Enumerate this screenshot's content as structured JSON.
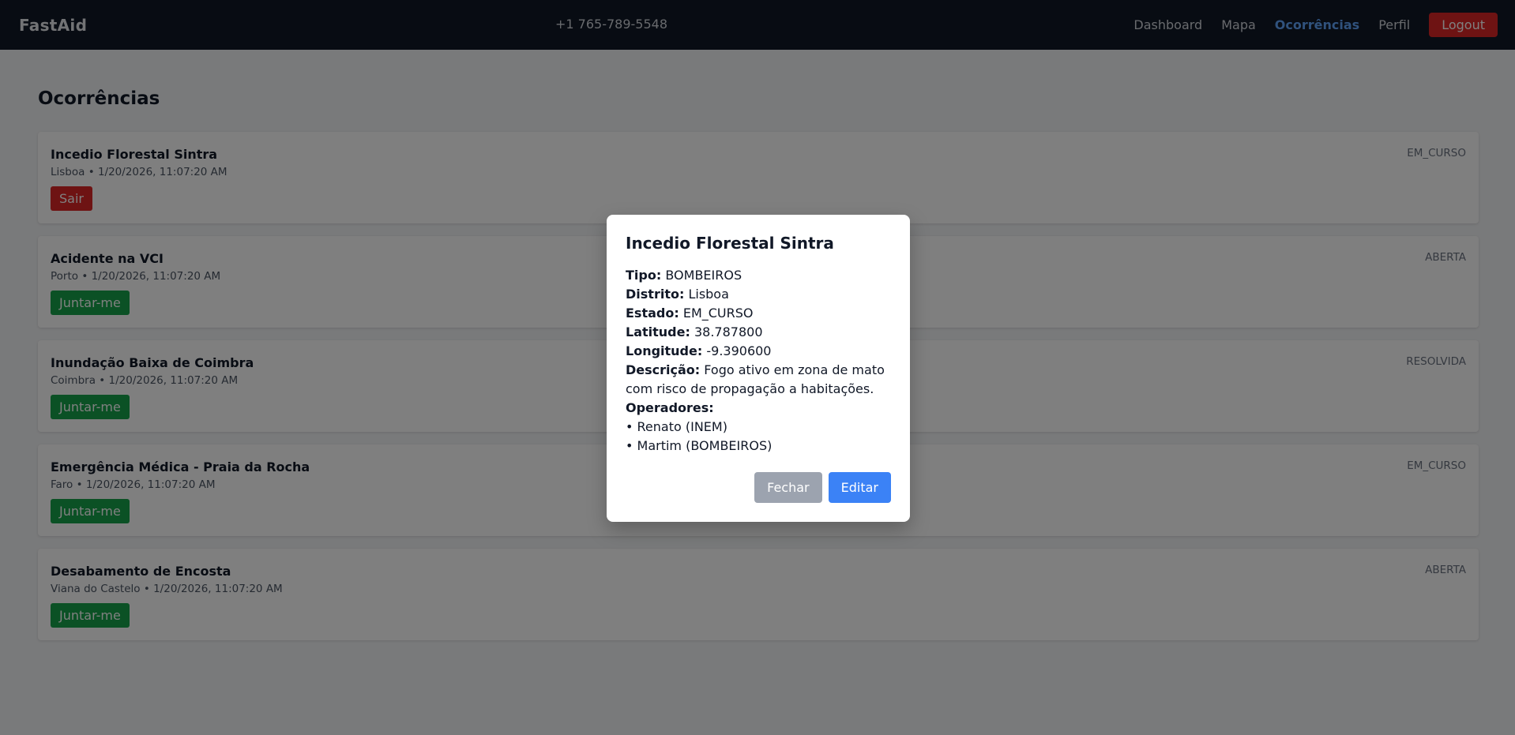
{
  "navbar": {
    "brand": "FastAid",
    "phone": "+1 765-789-5548",
    "links": [
      {
        "label": "Dashboard",
        "active": false
      },
      {
        "label": "Mapa",
        "active": false
      },
      {
        "label": "Ocorrências",
        "active": true
      },
      {
        "label": "Perfil",
        "active": false
      }
    ],
    "logout_label": "Logout"
  },
  "page": {
    "title": "Ocorrências",
    "occurrences": [
      {
        "title": "Incedio Florestal Sintra",
        "meta": "Lisboa • 1/20/2026, 11:07:20 AM",
        "status": "EM_CURSO",
        "action": "Sair"
      },
      {
        "title": "Acidente na VCI",
        "meta": "Porto • 1/20/2026, 11:07:20 AM",
        "status": "ABERTA",
        "action": "Juntar-me"
      },
      {
        "title": "Inundação Baixa de Coimbra",
        "meta": "Coimbra • 1/20/2026, 11:07:20 AM",
        "status": "RESOLVIDA",
        "action": "Juntar-me"
      },
      {
        "title": "Emergência Médica - Praia da Rocha",
        "meta": "Faro • 1/20/2026, 11:07:20 AM",
        "status": "EM_CURSO",
        "action": "Juntar-me"
      },
      {
        "title": "Desabamento de Encosta",
        "meta": "Viana do Castelo • 1/20/2026, 11:07:20 AM",
        "status": "ABERTA",
        "action": "Juntar-me"
      }
    ]
  },
  "modal": {
    "title": "Incedio Florestal Sintra",
    "fields": [
      {
        "label": "Tipo:",
        "value": "BOMBEIROS"
      },
      {
        "label": "Distrito:",
        "value": "Lisboa"
      },
      {
        "label": "Estado:",
        "value": "EM_CURSO"
      },
      {
        "label": "Latitude:",
        "value": "38.787800"
      },
      {
        "label": "Longitude:",
        "value": "-9.390600"
      },
      {
        "label": "Descrição:",
        "value": "Fogo ativo em zona de mato com risco de propagação a habitações."
      }
    ],
    "operators_label": "Operadores:",
    "operators": [
      "• Renato (INEM)",
      "• Martim (BOMBEIROS)"
    ],
    "close_label": "Fechar",
    "edit_label": "Editar"
  },
  "colors": {
    "navbar_bg": "#111827",
    "active_link": "#60a5fa",
    "danger": "#dc2626",
    "success": "#16a34a",
    "primary": "#3b82f6",
    "secondary": "#9ca3af"
  }
}
